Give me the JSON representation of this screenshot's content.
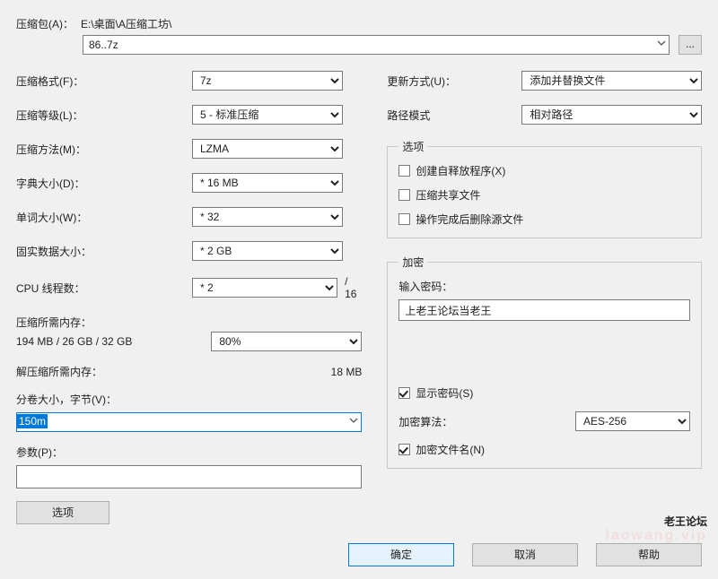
{
  "archive": {
    "label": "压缩包(A)：",
    "path_prefix": "E:\\桌面\\A压缩工坊\\",
    "filename": "86..7z",
    "browse": "..."
  },
  "left": {
    "format": {
      "label": "压缩格式(F)：",
      "value": "7z"
    },
    "level": {
      "label": "压缩等级(L)：",
      "value": "5 - 标准压缩"
    },
    "method": {
      "label": "压缩方法(M)：",
      "value": "LZMA"
    },
    "dict": {
      "label": "字典大小(D)：",
      "value": "* 16 MB"
    },
    "word": {
      "label": "单词大小(W)：",
      "value": "* 32"
    },
    "solid": {
      "label": "固实数据大小：",
      "value": "* 2 GB"
    },
    "threads": {
      "label": "CPU 线程数：",
      "value": "* 2",
      "total": "/ 16"
    },
    "mem_comp": {
      "label": "压缩所需内存：",
      "sub": "194 MB / 26 GB / 32 GB",
      "pct": "80%"
    },
    "mem_decomp": {
      "label": "解压缩所需内存：",
      "value": "18 MB"
    },
    "volume": {
      "label": "分卷大小，字节(V)：",
      "value": "150m"
    },
    "params": {
      "label": "参数(P)：",
      "value": ""
    },
    "options_btn": "选项"
  },
  "right": {
    "update": {
      "label": "更新方式(U)：",
      "value": "添加并替换文件"
    },
    "pathmode": {
      "label": "路径模式",
      "value": "相对路径"
    },
    "options_legend": "选项",
    "opt_sfx": "创建自释放程序(X)",
    "opt_shared": "压缩共享文件",
    "opt_delete": "操作完成后删除源文件",
    "enc_legend": "加密",
    "pw_label": "输入密码：",
    "pw_value": "上老王论坛当老王",
    "show_pw": "显示密码(S)",
    "enc_algo_label": "加密算法：",
    "enc_algo_value": "AES-256",
    "enc_names": "加密文件名(N)"
  },
  "footer": {
    "ok": "确定",
    "cancel": "取消",
    "help": "帮助"
  },
  "watermark": {
    "main": "老王论坛",
    "sub": "laowang.vip"
  }
}
